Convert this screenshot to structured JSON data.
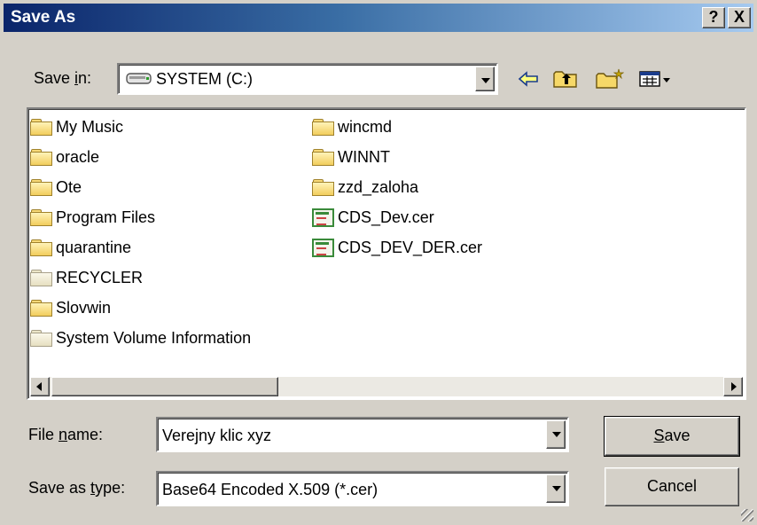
{
  "window": {
    "title": "Save As",
    "help_label": "?",
    "close_label": "X"
  },
  "save_in": {
    "label_pre": "Save ",
    "label_accel": "i",
    "label_post": "n:",
    "value": "SYSTEM (C:)",
    "drive_icon": "drive-icon"
  },
  "toolbar": {
    "icons": [
      "back-arrow-icon",
      "up-folder-icon",
      "new-folder-icon",
      "view-menu-icon"
    ]
  },
  "files": [
    {
      "name": "My Music",
      "type": "folder"
    },
    {
      "name": "oracle",
      "type": "folder"
    },
    {
      "name": "Ote",
      "type": "folder"
    },
    {
      "name": "Program Files",
      "type": "folder"
    },
    {
      "name": "quarantine",
      "type": "folder"
    },
    {
      "name": "RECYCLER",
      "type": "system-folder"
    },
    {
      "name": "Slovwin",
      "type": "folder"
    },
    {
      "name": "System Volume Information",
      "type": "system-folder"
    },
    {
      "name": "wincmd",
      "type": "folder"
    },
    {
      "name": "WINNT",
      "type": "folder"
    },
    {
      "name": "zzd_zaloha",
      "type": "folder"
    },
    {
      "name": "CDS_Dev.cer",
      "type": "certificate"
    },
    {
      "name": "CDS_DEV_DER.cer",
      "type": "certificate"
    }
  ],
  "file_name": {
    "label_pre": "File ",
    "label_accel": "n",
    "label_post": "ame:",
    "value": "Verejny klic xyz"
  },
  "save_type": {
    "label_pre": "Save as ",
    "label_accel": "t",
    "label_post": "ype:",
    "value": "Base64 Encoded X.509 (*.cer)"
  },
  "buttons": {
    "save_accel": "S",
    "save_rest": "ave",
    "cancel": "Cancel"
  },
  "colors": {
    "title_start": "#0a246a",
    "title_end": "#a6caf0",
    "face": "#d4d0c8",
    "folder": "#f2cd5c",
    "cert": "#3a8a3a"
  }
}
